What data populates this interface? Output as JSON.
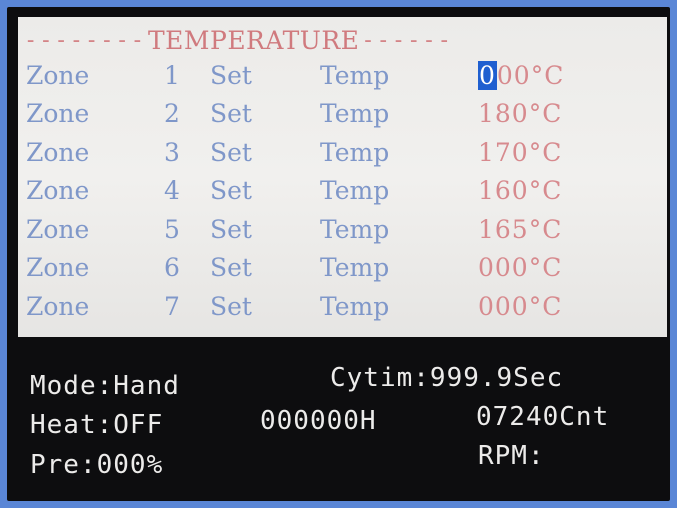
{
  "panel": {
    "title": "TEMPERATURE",
    "title_dashes_left": "--------",
    "title_dashes_right": "------",
    "cursor_color": "#1f5fd0",
    "zones": [
      {
        "word": "Zone",
        "number": "1",
        "set": "Set",
        "temp": "Temp",
        "cursor_digit": "0",
        "value_rest": "00°C"
      },
      {
        "word": "Zone",
        "number": "2",
        "set": "Set",
        "temp": "Temp",
        "cursor_digit": "",
        "value_rest": "180°C"
      },
      {
        "word": "Zone",
        "number": "3",
        "set": "Set",
        "temp": "Temp",
        "cursor_digit": "",
        "value_rest": "170°C"
      },
      {
        "word": "Zone",
        "number": "4",
        "set": "Set",
        "temp": "Temp",
        "cursor_digit": "",
        "value_rest": "160°C"
      },
      {
        "word": "Zone",
        "number": "5",
        "set": "Set",
        "temp": "Temp",
        "cursor_digit": "",
        "value_rest": "165°C"
      },
      {
        "word": "Zone",
        "number": "6",
        "set": "Set",
        "temp": "Temp",
        "cursor_digit": "",
        "value_rest": "000°C"
      },
      {
        "word": "Zone",
        "number": "7",
        "set": "Set",
        "temp": "Temp",
        "cursor_digit": "",
        "value_rest": "000°C"
      }
    ]
  },
  "status": {
    "mode": "Mode:Hand",
    "cytim": "Cytim:999.9Sec",
    "heat": "Heat:OFF",
    "hours": "000000H",
    "count": "07240Cnt",
    "pre": "Pre:000%",
    "rpm": "RPM:"
  }
}
